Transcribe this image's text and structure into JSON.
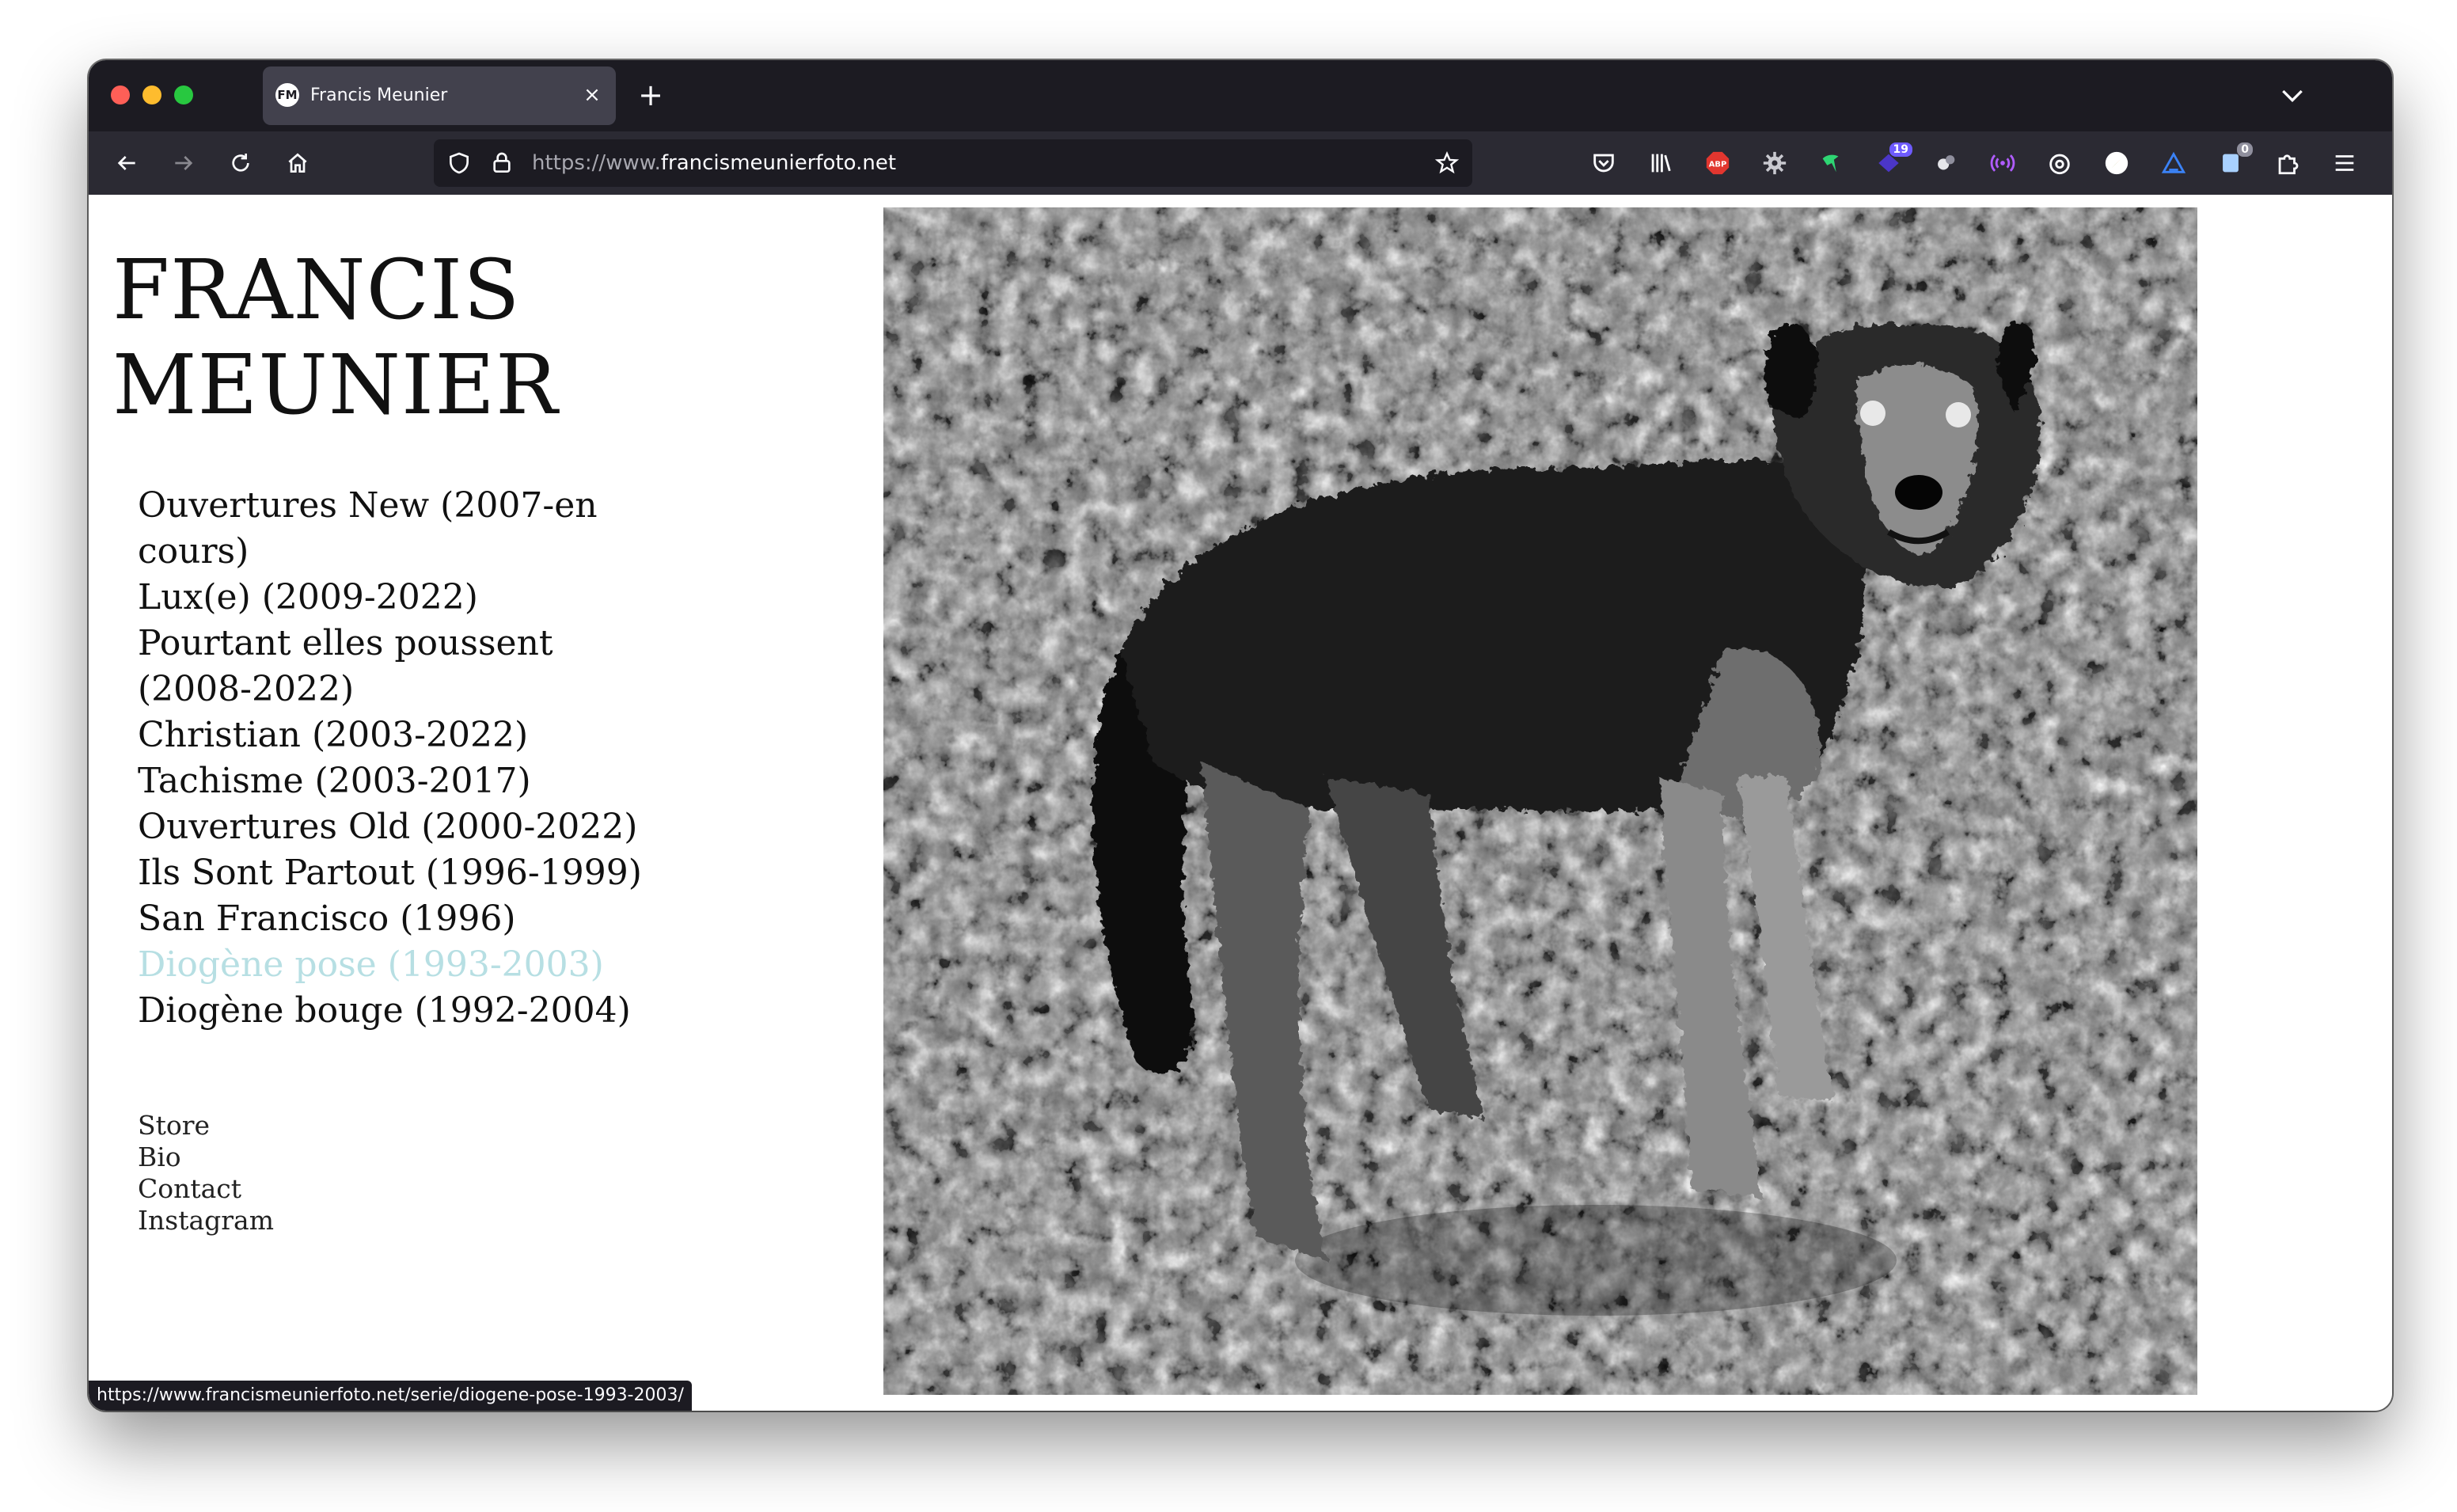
{
  "browser": {
    "tab_title": "Francis Meunier",
    "tab_favicon": "FM",
    "url_prefix": "https://www.",
    "url_domain": "francismeunierfoto.net",
    "status_url": "https://www.francismeunierfoto.net/serie/diogene-pose-1993-2003/",
    "extensions": [
      {
        "name": "pocket-icon"
      },
      {
        "name": "library-icon"
      },
      {
        "name": "adblock-icon",
        "label": "ABP"
      },
      {
        "name": "settings-gear-icon"
      },
      {
        "name": "green-bird-icon"
      },
      {
        "name": "purple-badge-icon",
        "badge": "19"
      },
      {
        "name": "dots-icon"
      },
      {
        "name": "wifi-icon"
      },
      {
        "name": "timer-icon"
      },
      {
        "name": "compass-icon"
      },
      {
        "name": "triangle-icon"
      },
      {
        "name": "notes-icon",
        "badge": "0"
      },
      {
        "name": "extensions-puzzle-icon"
      },
      {
        "name": "hamburger-menu-icon"
      }
    ]
  },
  "site": {
    "title_line1": "FRANCIS",
    "title_line2": "MEUNIER",
    "series": [
      {
        "line1": "Ouvertures New (2007-en",
        "line2": "cours)"
      },
      {
        "line1": "Lux(e) (2009-2022)"
      },
      {
        "line1": "Pourtant elles poussent",
        "line2": "(2008-2022)"
      },
      {
        "line1": "Christian (2003-2022)"
      },
      {
        "line1": "Tachisme (2003-2017)"
      },
      {
        "line1": "Ouvertures Old (2000-2022)"
      },
      {
        "line1": "Ils Sont Partout (1996-1999)"
      },
      {
        "line1": "San Francisco (1996)"
      },
      {
        "line1": "Diogène pose (1993-2003)",
        "active": true
      },
      {
        "line1": "Diogène bouge (1992-2004)"
      }
    ],
    "secondary": [
      "Store",
      "Bio",
      "Contact",
      "Instagram"
    ]
  },
  "colors": {
    "active_link": "#b7dfe3",
    "browser_dark": "#1c1b22",
    "toolbar": "#2b2a33"
  }
}
